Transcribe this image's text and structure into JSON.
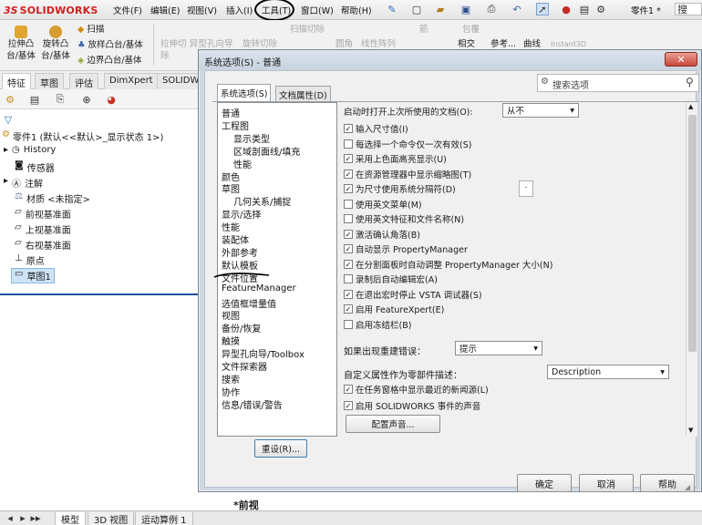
{
  "app": {
    "logo_ds": "3S",
    "logo_name": "SOLIDWORKS",
    "menus": [
      "文件(F)",
      "编辑(E)",
      "视图(V)",
      "插入(I)",
      "工具(T)",
      "窗口(W)",
      "帮助(H)"
    ],
    "doc_title": "零件1 *",
    "search_hint": "搜"
  },
  "command_manager": {
    "left_col": [
      {
        "label": "拉伸凸台/基体"
      },
      {
        "label": "旋转凸台/基体"
      }
    ],
    "sweep": "扫描",
    "loft": "放样凸台/基体",
    "boundary": "边界凸台/基体",
    "dim_items": [
      "拉伸切除",
      "异型孔向导",
      "旋转切除",
      "扫描切除",
      "圆角",
      "线性阵列",
      "筋",
      "包覆",
      "相交",
      "参考...",
      "曲线",
      "Instant3D"
    ]
  },
  "tabs": [
    "特征",
    "草图",
    "评估",
    "DimXpert",
    "SOLIDW"
  ],
  "tree": {
    "root": "零件1 (默认<<默认>_显示状态 1>)",
    "items": [
      "History",
      "传感器",
      "注解",
      "材质 <未指定>",
      "前视基准面",
      "上视基准面",
      "右视基准面",
      "原点",
      "草图1"
    ]
  },
  "graphics_label": "*前视",
  "bottom_tabs": [
    "模型",
    "3D 视图",
    "运动算例 1"
  ],
  "dialog": {
    "title": "系统选项(S) - 普通",
    "close": "✕",
    "tab_system": "系统选项(S)",
    "tab_doc": "文档属性(D)",
    "search_placeholder": "搜索选项",
    "categories": [
      {
        "label": "普通",
        "sub": false
      },
      {
        "label": "工程图",
        "sub": false
      },
      {
        "label": "显示类型",
        "sub": true
      },
      {
        "label": "区域剖面线/填充",
        "sub": true
      },
      {
        "label": "性能",
        "sub": true
      },
      {
        "label": "颜色",
        "sub": false
      },
      {
        "label": "草图",
        "sub": false
      },
      {
        "label": "几何关系/捕捉",
        "sub": true
      },
      {
        "label": "显示/选择",
        "sub": false
      },
      {
        "label": "性能",
        "sub": false
      },
      {
        "label": "装配体",
        "sub": false
      },
      {
        "label": "外部参考",
        "sub": false
      },
      {
        "label": "默认模板",
        "sub": false
      },
      {
        "label": "文件位置",
        "sub": false
      },
      {
        "label": "FeatureManager",
        "sub": false
      },
      {
        "label": "选值框增量值",
        "sub": false
      },
      {
        "label": "视图",
        "sub": false
      },
      {
        "label": "备份/恢复",
        "sub": false
      },
      {
        "label": "触摸",
        "sub": false
      },
      {
        "label": "异型孔向导/Toolbox",
        "sub": false
      },
      {
        "label": "文件探索器",
        "sub": false
      },
      {
        "label": "搜索",
        "sub": false
      },
      {
        "label": "协作",
        "sub": false
      },
      {
        "label": "信息/错误/警告",
        "sub": false
      }
    ],
    "reset_button": "重设(R)...",
    "open_last_label": "启动时打开上次所使用的文档(O):",
    "open_last_value": "从不",
    "options": [
      {
        "label": "输入尺寸值(I)",
        "checked": true
      },
      {
        "label": "每选择一个命令仅一次有效(S)",
        "checked": false
      },
      {
        "label": "采用上色面高亮显示(U)",
        "checked": true
      },
      {
        "label": "在资源管理器中显示缩略图(T)",
        "checked": true
      },
      {
        "label": "为尺寸使用系统分隔符(D)",
        "checked": true
      },
      {
        "label": "使用英文菜单(M)",
        "checked": false
      },
      {
        "label": "使用英文特征和文件名称(N)",
        "checked": false
      },
      {
        "label": "激活确认角落(B)",
        "checked": true
      },
      {
        "label": "自动显示 PropertyManager",
        "checked": true
      },
      {
        "label": "在分割面板时自动调整 PropertyManager 大小(N)",
        "checked": true
      },
      {
        "label": "录制后自动编辑宏(A)",
        "checked": false
      },
      {
        "label": "在退出宏时停止 VSTA 调试器(S)",
        "checked": true
      },
      {
        "label": "启用 FeatureXpert(E)",
        "checked": true
      },
      {
        "label": "启用冻结栏(B)",
        "checked": false
      }
    ],
    "separator_value": ".",
    "rebuild_error_label": "如果出现重建错误：",
    "rebuild_error_value": "提示",
    "custom_prop_label": "自定义属性作为零部件描述：",
    "custom_prop_value": "Description",
    "news_option": {
      "label": "在任务窗格中显示最近的新闻源(L)",
      "checked": true
    },
    "sound_option": {
      "label": "启用 SOLIDWORKS 事件的声音",
      "checked": true
    },
    "config_sound_button": "配置声音...",
    "ok": "确定",
    "cancel": "取消",
    "help": "帮助"
  }
}
